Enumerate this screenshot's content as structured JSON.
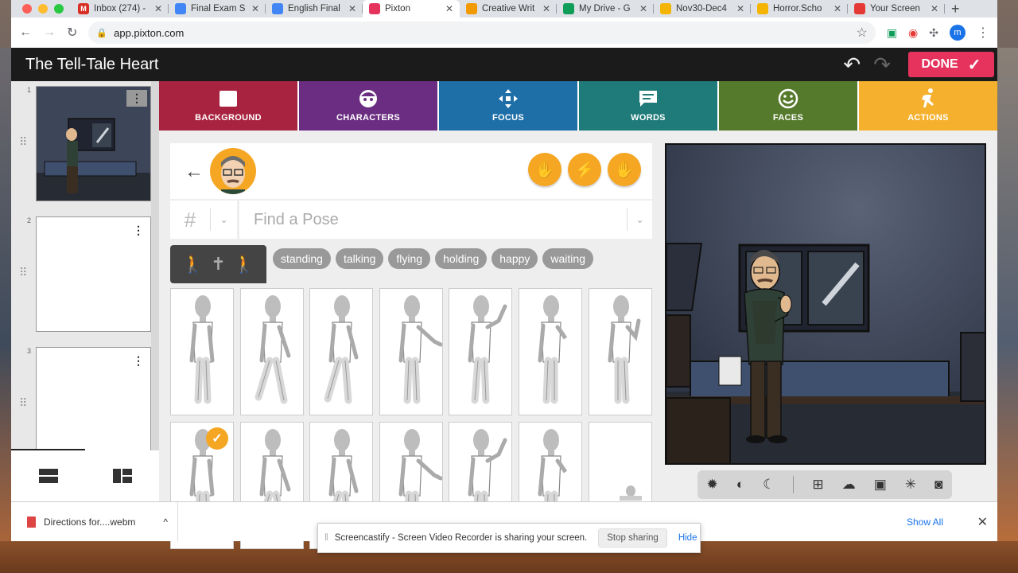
{
  "browser": {
    "tabs": [
      {
        "title": "Inbox (274) -",
        "icon": "gmail-icon",
        "color": "#d93025",
        "glyph": "M"
      },
      {
        "title": "Final Exam S",
        "icon": "doc-icon",
        "color": "#4285f4",
        "glyph": ""
      },
      {
        "title": "English Final",
        "icon": "slides-icon",
        "color": "#4285f4",
        "glyph": ""
      },
      {
        "title": "Pixton",
        "icon": "pixton-icon",
        "color": "#e6335e",
        "glyph": "",
        "active": true
      },
      {
        "title": "Creative Writ",
        "icon": "classroom-icon",
        "color": "#f29900",
        "glyph": ""
      },
      {
        "title": "My Drive - G",
        "icon": "drive-icon",
        "color": "#0f9d58",
        "glyph": ""
      },
      {
        "title": "Nov30-Dec4",
        "icon": "slides-icon",
        "color": "#f4b400",
        "glyph": ""
      },
      {
        "title": "Horror.Scho",
        "icon": "slides-icon",
        "color": "#f4b400",
        "glyph": ""
      },
      {
        "title": "Your Screen",
        "icon": "screencastify-icon",
        "color": "#e53935",
        "glyph": ""
      }
    ],
    "url": "app.pixton.com",
    "profile_initial": "m"
  },
  "app": {
    "title": "The Tell-Tale Heart",
    "done_label": "DONE"
  },
  "panels": [
    {
      "number": "1"
    },
    {
      "number": "2"
    },
    {
      "number": "3"
    }
  ],
  "categories": [
    {
      "label": "BACKGROUND",
      "color": "#a8233f",
      "icon": "image-icon"
    },
    {
      "label": "CHARACTERS",
      "color": "#6b2d82",
      "icon": "face-icon"
    },
    {
      "label": "FOCUS",
      "color": "#1e6fa8",
      "icon": "move-icon"
    },
    {
      "label": "WORDS",
      "color": "#1f7a7a",
      "icon": "speech-icon"
    },
    {
      "label": "FACES",
      "color": "#567a2c",
      "icon": "smiley-icon"
    },
    {
      "label": "ACTIONS",
      "color": "#f5b12e",
      "icon": "running-icon"
    }
  ],
  "pose": {
    "search_placeholder": "Find a Pose",
    "hash": "#",
    "tags": [
      "standing",
      "talking",
      "flying",
      "holding",
      "happy",
      "waiting"
    ]
  },
  "downloads": {
    "file": "Directions for....webm",
    "show_all": "Show All"
  },
  "share": {
    "message": "Screencastify - Screen Video Recorder is sharing your screen.",
    "stop": "Stop sharing",
    "hide": "Hide"
  }
}
